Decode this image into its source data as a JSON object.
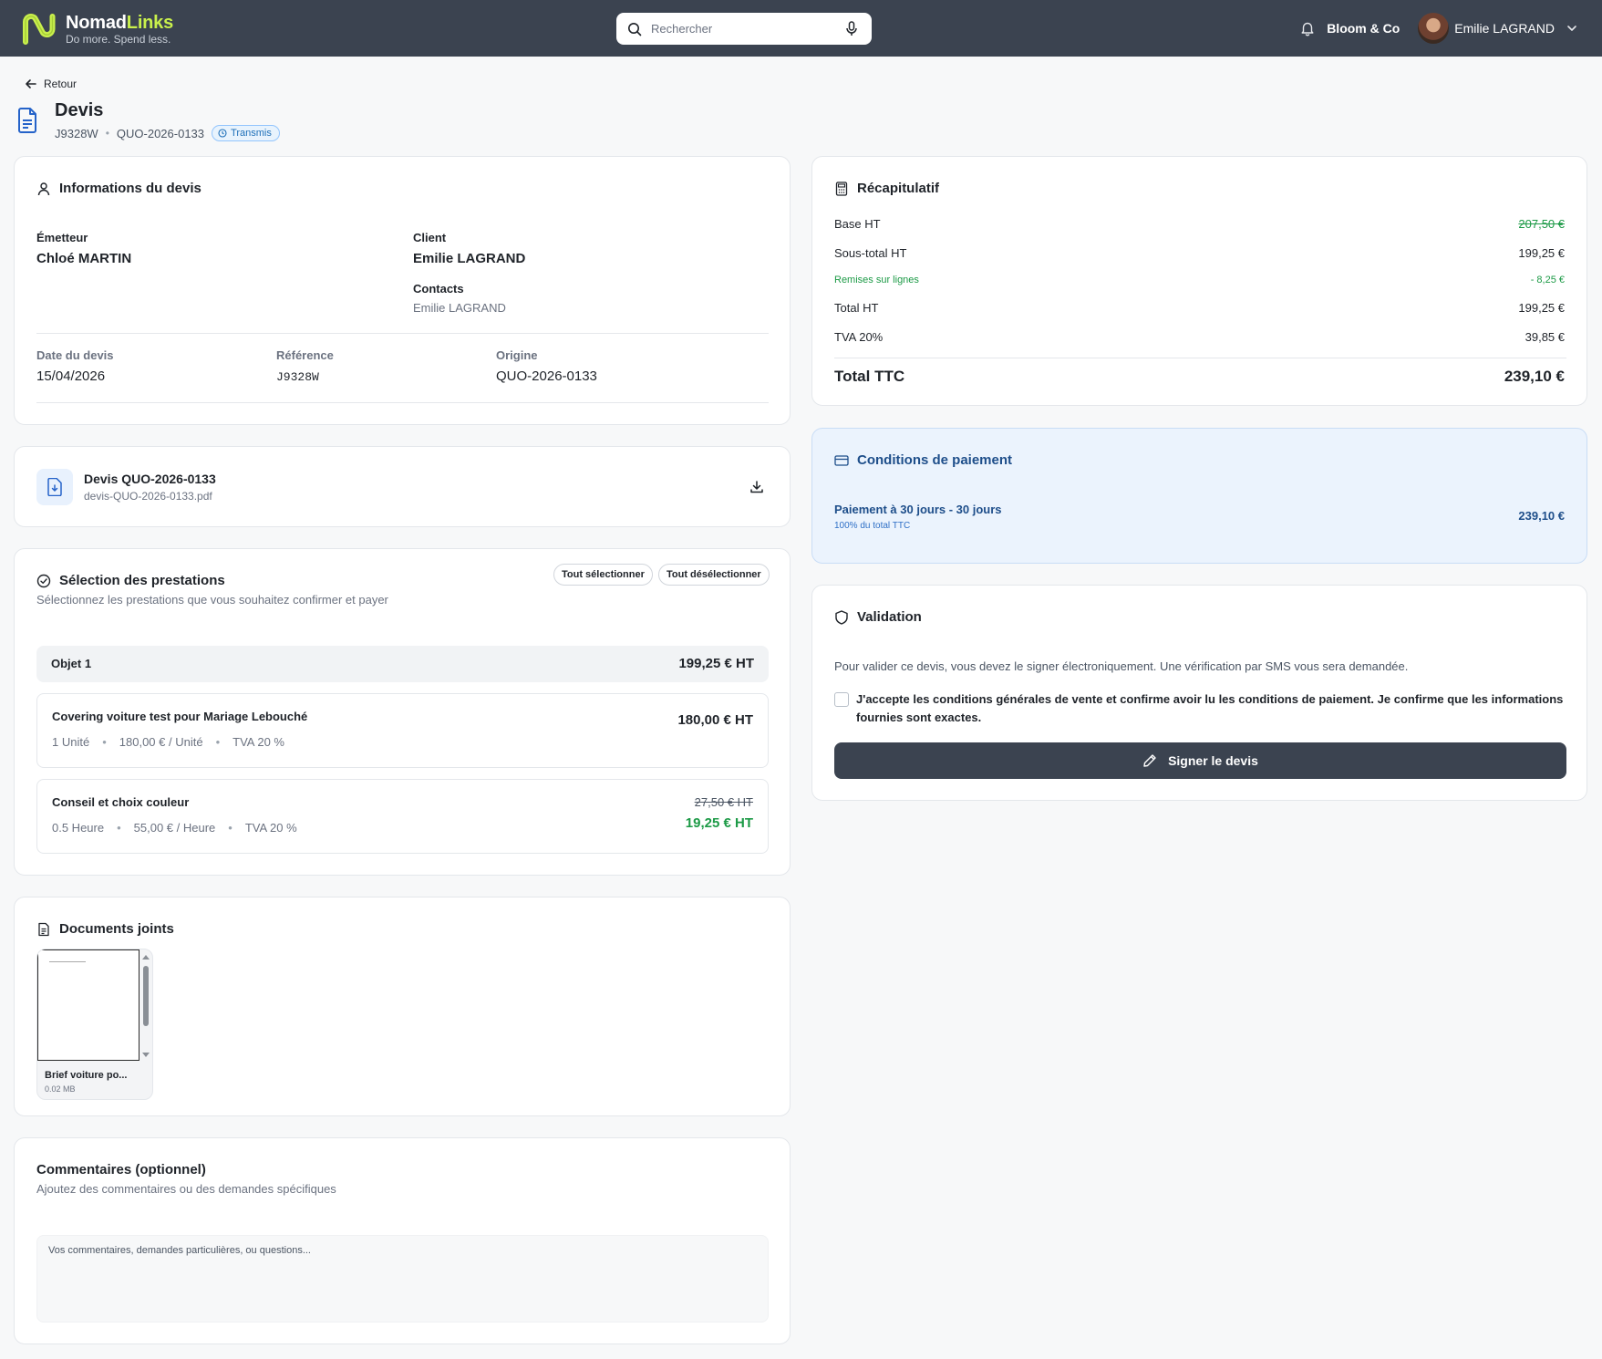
{
  "brand": {
    "name_part1": "Nomad",
    "name_part2": "Links",
    "tagline": "Do more. Spend less.",
    "accent_color": "#c9f04c"
  },
  "search": {
    "placeholder": "Rechercher"
  },
  "topbar": {
    "company": "Bloom & Co",
    "user_name": "Emilie LAGRAND"
  },
  "header": {
    "back_label": "Retour",
    "title": "Devis",
    "ref_code": "J9328W",
    "quote_number": "QUO-2026-0133",
    "status_badge": "Transmis"
  },
  "info": {
    "title": "Informations du devis",
    "emitter_label": "Émetteur",
    "emitter_value": "Chloé MARTIN",
    "client_label": "Client",
    "client_value": "Emilie LAGRAND",
    "contacts_label": "Contacts",
    "contacts_value": "Emilie LAGRAND",
    "date_label": "Date du devis",
    "date_value": "15/04/2026",
    "reference_label": "Référence",
    "reference_value": "J9328W",
    "origin_label": "Origine",
    "origin_value": "QUO-2026-0133"
  },
  "pdf": {
    "title": "Devis QUO-2026-0133",
    "filename": "devis-QUO-2026-0133.pdf"
  },
  "prestations": {
    "title": "Sélection des prestations",
    "select_all": "Tout sélectionner",
    "deselect_all": "Tout désélectionner",
    "description": "Sélectionnez les prestations que vous souhaitez confirmer et payer",
    "group_name": "Objet 1",
    "group_total": "199,25 € HT",
    "items": [
      {
        "name": "Covering voiture test pour Mariage Lebouché",
        "qty": "1 Unité",
        "unit_price": "180,00 € / Unité",
        "tva": "TVA 20 %",
        "price": "180,00 € HT"
      },
      {
        "name": "Conseil et choix couleur",
        "qty": "0.5 Heure",
        "unit_price": "55,00 € / Heure",
        "tva": "TVA 20 %",
        "old_price": "27,50 € HT",
        "price": "19,25 € HT"
      }
    ]
  },
  "attachments": {
    "title": "Documents joints",
    "items": [
      {
        "name": "Brief voiture po...",
        "size": "0.02 MB"
      }
    ]
  },
  "comments": {
    "title": "Commentaires (optionnel)",
    "description": "Ajoutez des commentaires ou des demandes spécifiques",
    "placeholder": "Vos commentaires, demandes particulières, ou questions..."
  },
  "summary": {
    "title": "Récapitulatif",
    "rows": [
      {
        "label": "Base HT",
        "value": "207,50 €"
      },
      {
        "label": "Sous-total HT",
        "value": "199,25 €"
      },
      {
        "label": "Remises sur lignes",
        "value": "- 8,25 €"
      },
      {
        "label": "Total HT",
        "value": "199,25 €"
      },
      {
        "label": "TVA 20%",
        "value": "39,85 €"
      }
    ],
    "total_label": "Total TTC",
    "total_value": "239,10 €"
  },
  "payment": {
    "title": "Conditions de paiement",
    "term": "Paiement à 30 jours - 30 jours",
    "subtext": "100% du total TTC",
    "amount": "239,10 €"
  },
  "validation": {
    "title": "Validation",
    "text": "Pour valider ce devis, vous devez le signer électroniquement. Une vérification par SMS vous sera demandée.",
    "checkbox_label": "J'accepte les conditions générales de vente et confirme avoir lu les conditions de paiement. Je confirme que les informations fournies sont exactes.",
    "sign_button": "Signer le devis"
  },
  "colors": {
    "topbar": "#3b4350",
    "green": "#1c9a46",
    "blue": "#1e4e8a",
    "payment_bg": "#ebf3fd"
  }
}
